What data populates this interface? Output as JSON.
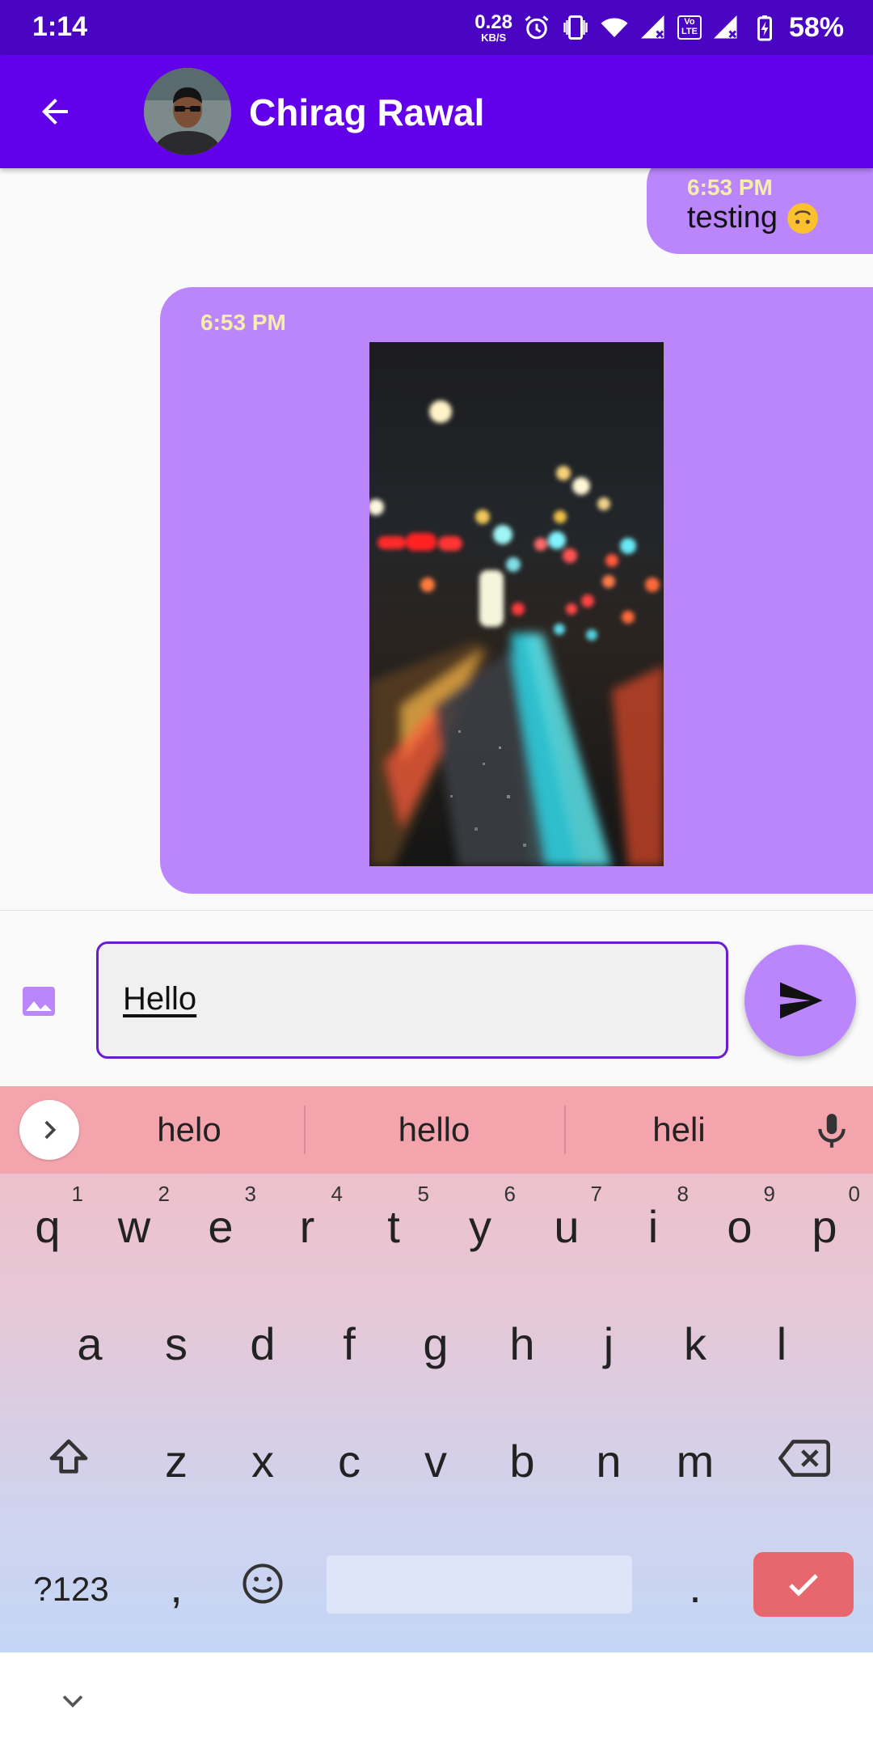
{
  "status_bar": {
    "time": "1:14",
    "speed_value": "0.28",
    "speed_unit": "KB/S",
    "lte_label_1": "Vo",
    "lte_label_2": "LTE",
    "battery": "58%",
    "icons": [
      "alarm-icon",
      "vibrate-icon",
      "wifi-icon",
      "signal-icon",
      "signal-icon",
      "battery-charging-icon"
    ]
  },
  "app_bar": {
    "title": "Chirag Rawal",
    "back_icon": "arrow-back-icon",
    "bg_color": "#6200ea"
  },
  "messages": [
    {
      "time": "6:53 PM",
      "text": "testing",
      "emoji": "upside-down-face"
    },
    {
      "time": "6:53 PM",
      "type": "image",
      "image": "night-street-bokeh-photo"
    }
  ],
  "composer": {
    "input_value": "Hello",
    "gallery_icon": "image-icon",
    "send_icon": "send-icon",
    "accent": "#bb86fc"
  },
  "keyboard": {
    "suggestions": [
      "helo",
      "hello",
      "heli"
    ],
    "row1": [
      {
        "k": "q",
        "h": "1"
      },
      {
        "k": "w",
        "h": "2"
      },
      {
        "k": "e",
        "h": "3"
      },
      {
        "k": "r",
        "h": "4"
      },
      {
        "k": "t",
        "h": "5"
      },
      {
        "k": "y",
        "h": "6"
      },
      {
        "k": "u",
        "h": "7"
      },
      {
        "k": "i",
        "h": "8"
      },
      {
        "k": "o",
        "h": "9"
      },
      {
        "k": "p",
        "h": "0"
      }
    ],
    "row2": [
      "a",
      "s",
      "d",
      "f",
      "g",
      "h",
      "j",
      "k",
      "l"
    ],
    "row3": [
      "z",
      "x",
      "c",
      "v",
      "b",
      "n",
      "m"
    ],
    "symbols_label": "?123",
    "comma": ",",
    "period": "."
  }
}
